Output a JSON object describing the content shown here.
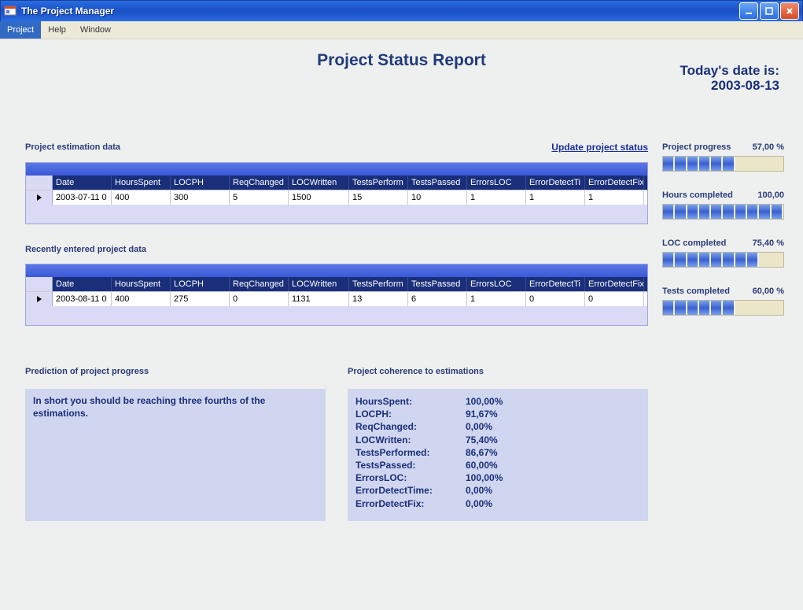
{
  "window": {
    "title": "The Project Manager"
  },
  "menu": {
    "items": [
      "Project",
      "Help",
      "Window"
    ],
    "active_index": 0
  },
  "page": {
    "title": "Project Status Report",
    "date_label": "Today's date is:",
    "date_value": "2003-08-13"
  },
  "links": {
    "update_status": "Update project status"
  },
  "sections": {
    "estimation": "Project estimation data",
    "recent": "Recently entered project data",
    "prediction": "Prediction of project progress",
    "coherence": "Project coherence to estimations"
  },
  "grid_columns": [
    "Date",
    "HoursSpent",
    "LOCPH",
    "ReqChanged",
    "LOCWritten",
    "TestsPerform",
    "TestsPassed",
    "ErrorsLOC",
    "ErrorDetectTi",
    "ErrorDetectFix"
  ],
  "estimation_row": [
    "2003-07-11 0",
    "400",
    "300",
    "5",
    "1500",
    "15",
    "10",
    "1",
    "1",
    "1"
  ],
  "recent_row": [
    "2003-08-11 0",
    "400",
    "275",
    "0",
    "1131",
    "13",
    "6",
    "1",
    "0",
    "0"
  ],
  "progress": [
    {
      "label": "Project progress",
      "value": "57,00 %",
      "fill": 57
    },
    {
      "label": "Hours completed",
      "value": "100,00",
      "fill": 100
    },
    {
      "label": "LOC completed",
      "value": "75,40 %",
      "fill": 75.4
    },
    {
      "label": "Tests completed",
      "value": "60,00 %",
      "fill": 60
    }
  ],
  "prediction_text": "In short you should be reaching three fourths of the estimations.",
  "coherence": [
    {
      "label": "HoursSpent:",
      "value": "100,00%"
    },
    {
      "label": "LOCPH:",
      "value": "91,67%"
    },
    {
      "label": "ReqChanged:",
      "value": "0,00%"
    },
    {
      "label": "LOCWritten:",
      "value": "75,40%"
    },
    {
      "label": "TestsPerformed:",
      "value": "86,67%"
    },
    {
      "label": "TestsPassed:",
      "value": "60,00%"
    },
    {
      "label": "ErrorsLOC:",
      "value": "100,00%"
    },
    {
      "label": "ErrorDetectTime:",
      "value": "0,00%"
    },
    {
      "label": "ErrorDetectFix:",
      "value": "0,00%"
    }
  ]
}
